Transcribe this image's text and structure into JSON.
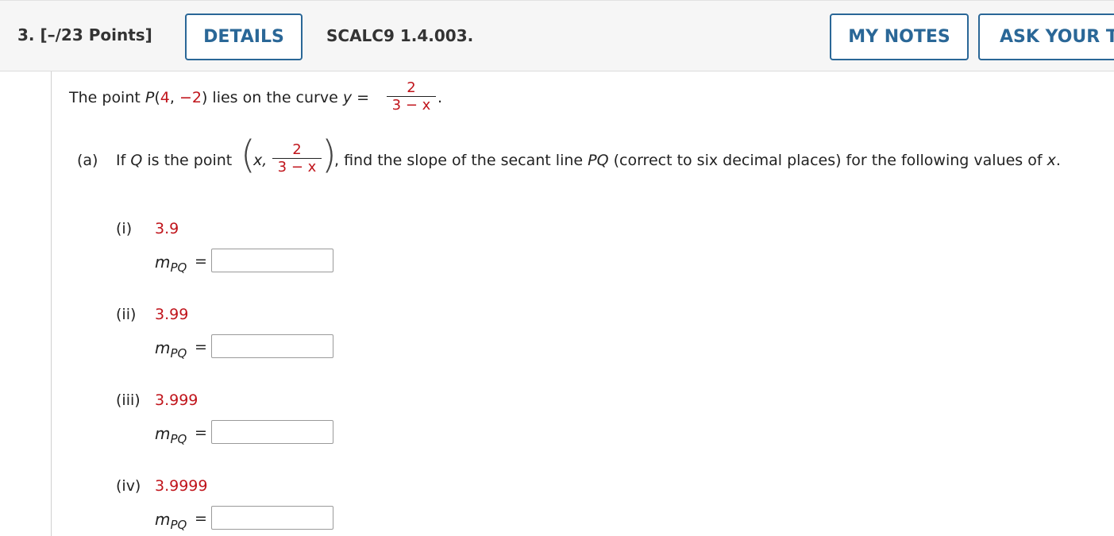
{
  "header": {
    "question_number": "3.",
    "points": "[–/23 Points]",
    "details_label": "DETAILS",
    "problem_code": "SCALC9 1.4.003.",
    "notes_label": "MY NOTES",
    "ask_label": "ASK YOUR TE"
  },
  "intro": {
    "prefix": "The point ",
    "P": "P",
    "open": "(",
    "x": "4",
    "comma": ", ",
    "y": "−2",
    "close": ")",
    "mid": " lies on the curve ",
    "yvar": "y",
    "equals": " = ",
    "num": "2",
    "den": "3 − x",
    "period": "."
  },
  "part_a": {
    "label": "(a)",
    "text1": "If ",
    "Q": "Q",
    "text2": " is the point ",
    "xvar": "x,",
    "num": "2",
    "den": "3 − x",
    "text3": ", find the slope of the secant line ",
    "PQ": "PQ",
    "text4": " (correct to six decimal places) for the following values of ",
    "xend": "x",
    "period": "."
  },
  "subparts": [
    {
      "label": "(i)",
      "value": "3.9",
      "m": "m",
      "sub": "PQ",
      "eq": "=",
      "answer": ""
    },
    {
      "label": "(ii)",
      "value": "3.99",
      "m": "m",
      "sub": "PQ",
      "eq": "=",
      "answer": ""
    },
    {
      "label": "(iii)",
      "value": "3.999",
      "m": "m",
      "sub": "PQ",
      "eq": "=",
      "answer": ""
    },
    {
      "label": "(iv)",
      "value": "3.9999",
      "m": "m",
      "sub": "PQ",
      "eq": "=",
      "answer": ""
    }
  ],
  "colors": {
    "accent": "#2a6797",
    "given_value": "#c0141b"
  }
}
